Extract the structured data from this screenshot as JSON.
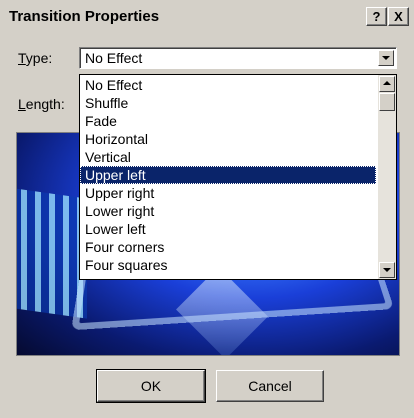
{
  "window": {
    "title": "Transition Properties",
    "help_label": "?",
    "close_label": "X"
  },
  "form": {
    "type_label_prefix": "T",
    "type_label_rest": "ype:",
    "length_label_prefix": "L",
    "length_label_rest": "ength:"
  },
  "type_select": {
    "value": "No Effect",
    "options": [
      "No Effect",
      "Shuffle",
      "Fade",
      "Horizontal",
      "Vertical",
      "Upper left",
      "Upper right",
      "Lower right",
      "Lower left",
      "Four corners",
      "Four squares"
    ],
    "highlighted": "Upper left"
  },
  "buttons": {
    "ok_label": "OK",
    "cancel_label": "Cancel"
  },
  "icons": [
    "help-icon",
    "close-icon",
    "chevron-down-icon",
    "scroll-up-icon",
    "scroll-down-icon"
  ],
  "colors": {
    "dialog_bg": "#d4d0c8",
    "selection_bg": "#0a246a",
    "selection_fg": "#ffffff"
  }
}
